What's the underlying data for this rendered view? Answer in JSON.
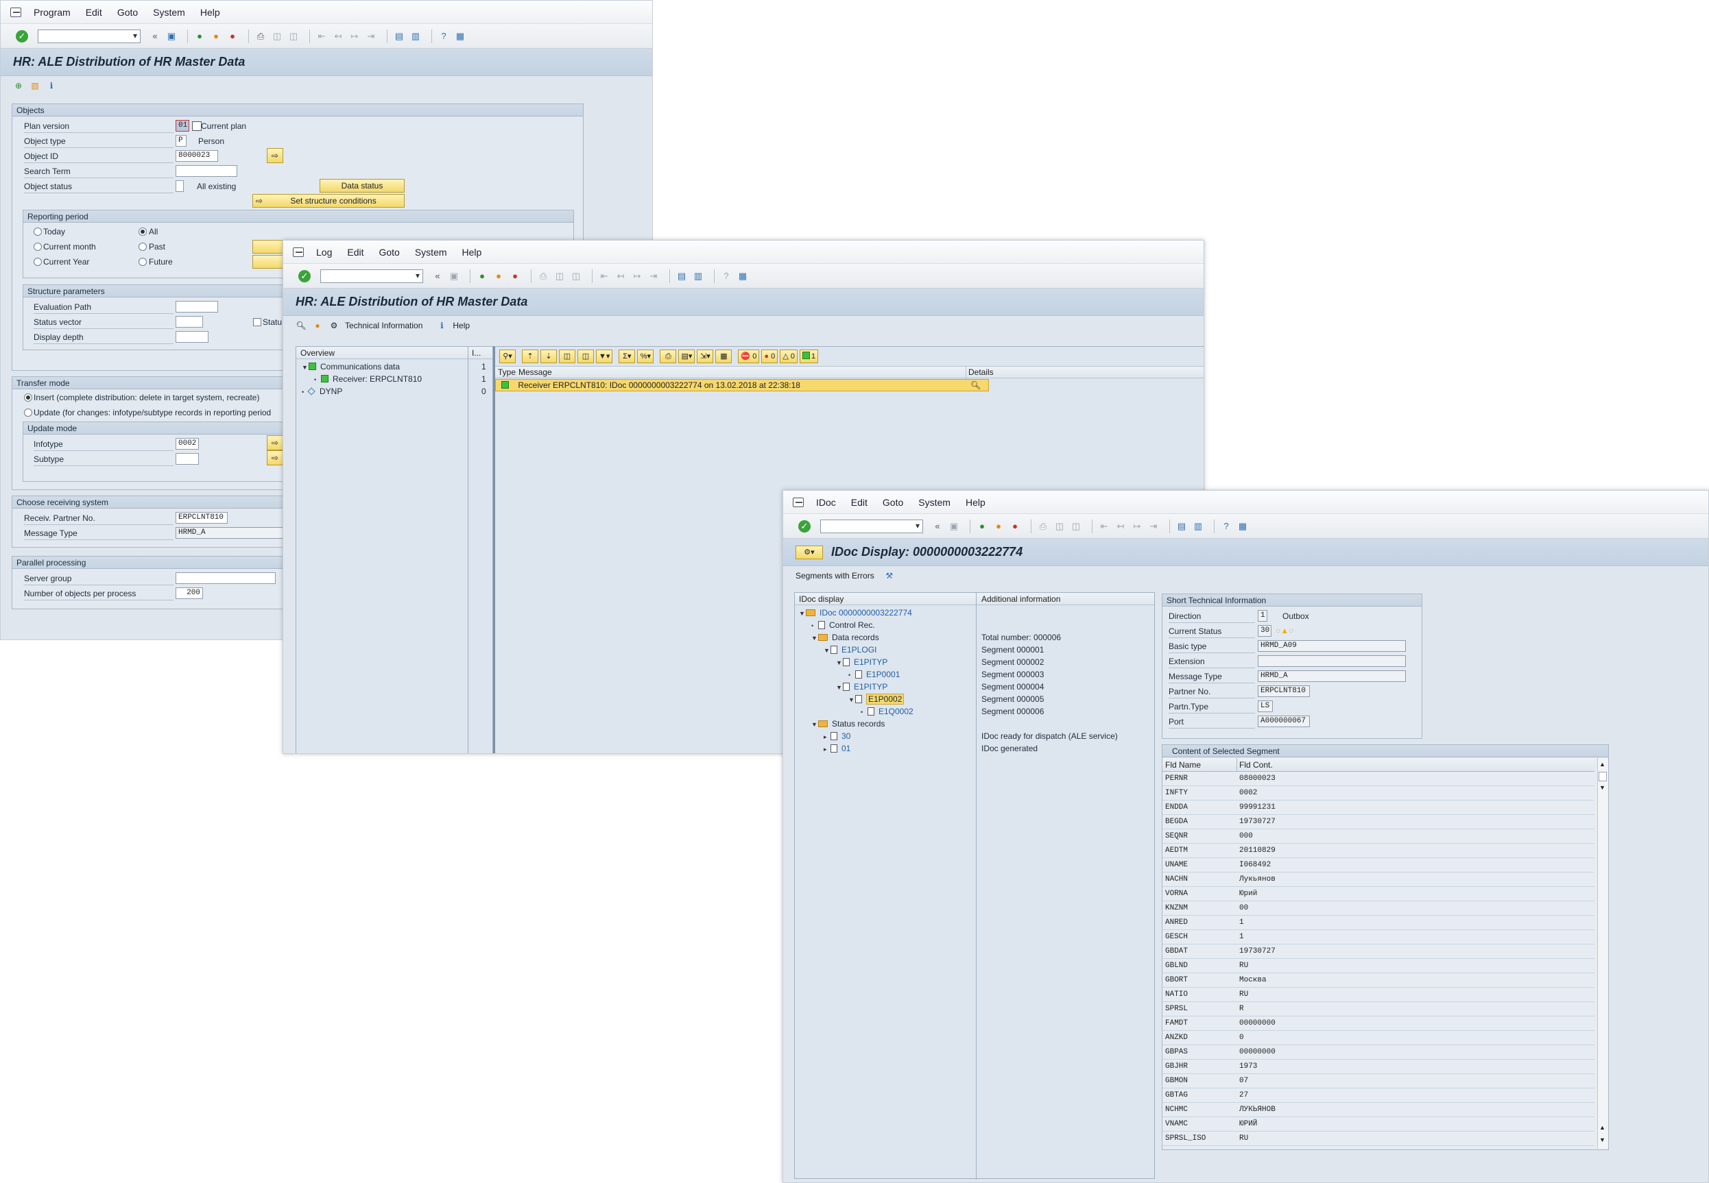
{
  "window1": {
    "menu": [
      "Program",
      "Edit",
      "Goto",
      "System",
      "Help"
    ],
    "title": "HR: ALE Distribution of HR Master Data",
    "objects": {
      "header": "Objects",
      "plan_version_label": "Plan version",
      "plan_version_value": "01",
      "plan_version_text": "Current plan",
      "object_type_label": "Object type",
      "object_type_value": "P",
      "object_type_text": "Person",
      "object_id_label": "Object ID",
      "object_id_value": "8000023",
      "search_term_label": "Search Term",
      "object_status_label": "Object status",
      "object_status_text": "All existing",
      "data_status_button": "Data status",
      "set_structure_button": "Set structure conditions"
    },
    "reporting": {
      "header": "Reporting period",
      "options": [
        "Today",
        "All",
        "Current month",
        "Past",
        "Current Year",
        "Future"
      ],
      "selected": "All"
    },
    "structure": {
      "header": "Structure parameters",
      "eval_path_label": "Evaluation Path",
      "status_vector_label": "Status vector",
      "display_depth_label": "Display depth",
      "status_chk_label": "Statu"
    },
    "transfer": {
      "header": "Transfer mode",
      "insert_label": "Insert (complete distribution: delete in target system, recreate)",
      "update_label": "Update (for changes: infotype/subtype records in reporting period",
      "update_mode_header": "Update mode",
      "infotype_label": "Infotype",
      "infotype_value": "0002",
      "subtype_label": "Subtype"
    },
    "receiving": {
      "header": "Choose receiving system",
      "partner_label": "Receiv. Partner No.",
      "partner_value": "ERPCLNT810",
      "msgtype_label": "Message Type",
      "msgtype_value": "HRMD_A"
    },
    "parallel": {
      "header": "Parallel processing",
      "server_group_label": "Server group",
      "objects_per_process_label": "Number of objects per process",
      "objects_per_process_value": "200"
    }
  },
  "window2": {
    "menu": [
      "Log",
      "Edit",
      "Goto",
      "System",
      "Help"
    ],
    "title": "HR: ALE Distribution of HR Master Data",
    "app_toolbar": {
      "tech_info": "Technical Information",
      "help": "Help"
    },
    "overview": {
      "header": "Overview",
      "count_header": "I...",
      "rows": [
        {
          "label": "Communications data",
          "count": "1"
        },
        {
          "label": "Receiver: ERPCLNT810",
          "count": "1"
        },
        {
          "label": "DYNP",
          "count": "0"
        }
      ]
    },
    "alv_counters": {
      "stop": "0",
      "error": "0",
      "warning": "0",
      "ok": "1"
    },
    "messages": {
      "col_type": "Type",
      "col_message": "Message",
      "col_details": "Details",
      "row_text": "Receiver ERPCLNT810: IDoc 0000000003222774 on 13.02.2018 at 22:38:18"
    }
  },
  "window3": {
    "menu": [
      "IDoc",
      "Edit",
      "Goto",
      "System",
      "Help"
    ],
    "title": "IDoc Display: 0000000003222774",
    "segments_with_errors": "Segments with Errors",
    "tree": {
      "header_left": "IDoc display",
      "header_right": "Additional information",
      "rows": [
        {
          "label": "IDoc 0000000003222774",
          "info": ""
        },
        {
          "label": "Control Rec.",
          "info": ""
        },
        {
          "label": "Data records",
          "info": "Total number: 000006"
        },
        {
          "label": "E1PLOGI",
          "info": "Segment 000001"
        },
        {
          "label": "E1PITYP",
          "info": "Segment 000002"
        },
        {
          "label": "E1P0001",
          "info": "Segment 000003"
        },
        {
          "label": "E1PITYP",
          "info": "Segment 000004"
        },
        {
          "label": "E1P0002",
          "info": "Segment 000005"
        },
        {
          "label": "E1Q0002",
          "info": "Segment 000006"
        },
        {
          "label": "Status records",
          "info": ""
        },
        {
          "label": "30",
          "info": "IDoc ready for dispatch (ALE service)"
        },
        {
          "label": "01",
          "info": "IDoc generated"
        }
      ]
    },
    "short_tech": {
      "header": "Short Technical Information",
      "direction_label": "Direction",
      "direction_value": "1",
      "direction_text": "Outbox",
      "status_label": "Current Status",
      "status_value": "30",
      "basic_type_label": "Basic type",
      "basic_type_value": "HRMD_A09",
      "extension_label": "Extension",
      "message_type_label": "Message Type",
      "message_type_value": "HRMD_A",
      "partner_no_label": "Partner No.",
      "partner_no_value": "ERPCLNT810",
      "partn_type_label": "Partn.Type",
      "partn_type_value": "LS",
      "port_label": "Port",
      "port_value": "A000000067"
    },
    "segment": {
      "header": "Content of Selected Segment",
      "col_name": "Fld Name",
      "col_cont": "Fld Cont.",
      "rows": [
        [
          "PERNR",
          "08000023"
        ],
        [
          "INFTY",
          "0002"
        ],
        [
          "ENDDA",
          "99991231"
        ],
        [
          "BEGDA",
          "19730727"
        ],
        [
          "SEQNR",
          "000"
        ],
        [
          "AEDTM",
          "20110829"
        ],
        [
          "UNAME",
          "I068492"
        ],
        [
          "NACHN",
          "Лукьянов"
        ],
        [
          "VORNA",
          "Юрий"
        ],
        [
          "KNZNM",
          "00"
        ],
        [
          "ANRED",
          "1"
        ],
        [
          "GESCH",
          "1"
        ],
        [
          "GBDAT",
          "19730727"
        ],
        [
          "GBLND",
          "RU"
        ],
        [
          "GBORT",
          "Москва"
        ],
        [
          "NATIO",
          "RU"
        ],
        [
          "SPRSL",
          "R"
        ],
        [
          "FAMDT",
          "00000000"
        ],
        [
          "ANZKD",
          "0"
        ],
        [
          "GBPAS",
          "00000000"
        ],
        [
          "GBJHR",
          "1973"
        ],
        [
          "GBMON",
          "07"
        ],
        [
          "GBTAG",
          "27"
        ],
        [
          "NCHMC",
          "ЛУКЬЯНОВ"
        ],
        [
          "VNAMC",
          "ЮРИЙ"
        ],
        [
          "SPRSL_ISO",
          "RU"
        ]
      ]
    }
  }
}
